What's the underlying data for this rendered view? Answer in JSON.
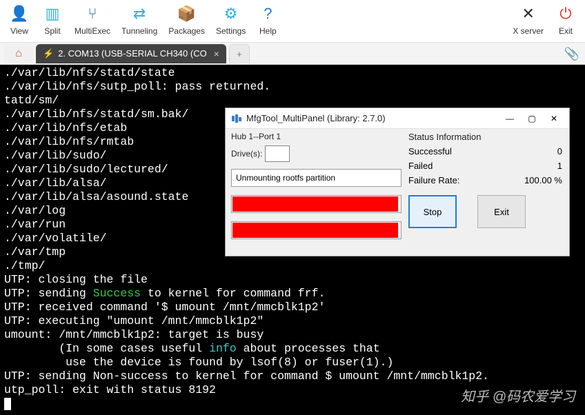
{
  "toolbar": {
    "items_left": [
      {
        "label": "View",
        "icon": "👤",
        "name": "view-button"
      },
      {
        "label": "Split",
        "icon": "▥",
        "name": "split-button"
      },
      {
        "label": "MultiExec",
        "icon": "⑂",
        "name": "multiexec-button"
      },
      {
        "label": "Tunneling",
        "icon": "⇄",
        "name": "tunneling-button"
      },
      {
        "label": "Packages",
        "icon": "📦",
        "name": "packages-button"
      },
      {
        "label": "Settings",
        "icon": "⚙",
        "name": "settings-button"
      },
      {
        "label": "Help",
        "icon": "?",
        "name": "help-button"
      }
    ],
    "items_right": [
      {
        "label": "X server",
        "icon": "✕",
        "name": "xserver-button"
      },
      {
        "label": "Exit",
        "icon": "⏻",
        "name": "exit-button"
      }
    ]
  },
  "tabs": {
    "home_icon": "⌂",
    "active": {
      "icon": "⚡",
      "label": "2. COM13  (USB-SERIAL CH340 (CO"
    },
    "newtab": "+"
  },
  "terminal_lines": [
    {
      "t": "./var/lib/nfs/statd/state"
    },
    {
      "t": "./var/lib/nfs/sutp_poll: pass returned."
    },
    {
      "t": "tatd/sm/"
    },
    {
      "t": "./var/lib/nfs/statd/sm.bak/"
    },
    {
      "t": "./var/lib/nfs/etab"
    },
    {
      "t": "./var/lib/nfs/rmtab"
    },
    {
      "t": "./var/lib/sudo/"
    },
    {
      "t": "./var/lib/sudo/lectured/"
    },
    {
      "t": "./var/lib/alsa/"
    },
    {
      "t": "./var/lib/alsa/asound.state"
    },
    {
      "t": "./var/log"
    },
    {
      "t": "./var/run"
    },
    {
      "t": "./var/volatile/"
    },
    {
      "t": "./var/tmp"
    },
    {
      "t": "./tmp/"
    },
    {
      "t": "UTP: closing the file"
    },
    {
      "pre": "UTP: sending ",
      "hl": "Success",
      "hlc": "green",
      "post": " to kernel for command frf."
    },
    {
      "t": "UTP: received command '$ umount /mnt/mmcblk1p2'"
    },
    {
      "t": "UTP: executing \"umount /mnt/mmcblk1p2\""
    },
    {
      "t": "umount: /mnt/mmcblk1p2: target is busy"
    },
    {
      "pre": "        (In some cases useful ",
      "hl": "info",
      "hlc": "cyan",
      "post": " about processes that"
    },
    {
      "t": "         use the device is found by lsof(8) or fuser(1).)"
    },
    {
      "t": "UTP: sending Non-success to kernel for command $ umount /mnt/mmcblk1p2."
    },
    {
      "t": "utp_poll: exit with status 8192"
    }
  ],
  "watermark": "知乎 @码农爱学习",
  "dialog": {
    "title": "MfgTool_MultiPanel (Library: 2.7.0)",
    "hub_label": "Hub 1--Port 1",
    "drives_label": "Drive(s):",
    "drives_value": "",
    "operation": "Unmounting rootfs partition",
    "progress1_pct": 98,
    "progress2_pct": 98,
    "status_header": "Status Information",
    "rows": [
      {
        "k": "Successful",
        "v": "0"
      },
      {
        "k": "Failed",
        "v": "1"
      },
      {
        "k": "Failure Rate:",
        "v": "100.00 %"
      }
    ],
    "btn_stop": "Stop",
    "btn_exit": "Exit"
  }
}
